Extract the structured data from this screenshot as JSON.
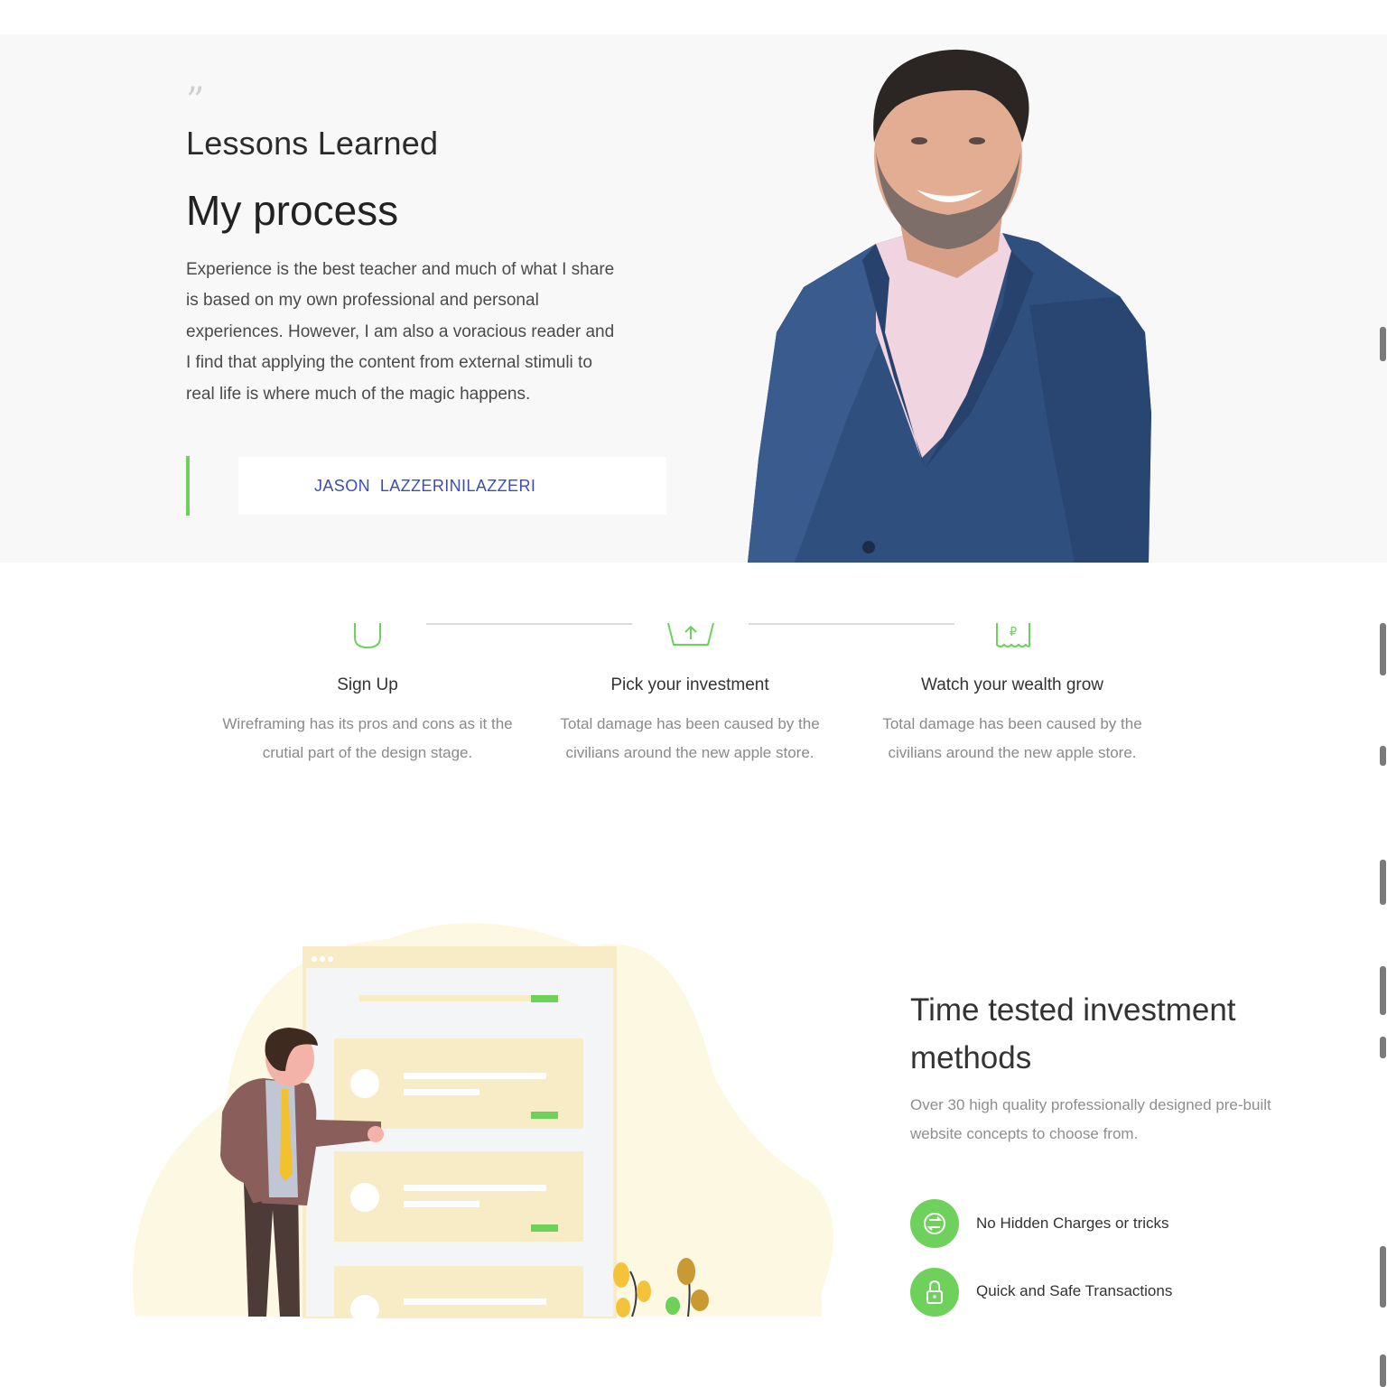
{
  "hero": {
    "quote_glyph": "”",
    "subtitle": "Lessons Learned",
    "title": "My process",
    "body": "Experience is the best teacher and much of what I share is based on my own professional and personal experiences.  However, I am also a voracious reader and I find that applying the content from external stimuli to real life is where much of the magic happens.",
    "author": "JASON  LAZZERINILAZZERI"
  },
  "steps": [
    {
      "icon": "wallet-icon",
      "title": "Sign Up",
      "desc": "Wireframing has its pros and cons as it the crutial part of the design stage."
    },
    {
      "icon": "upload-basket-icon",
      "title": "Pick your investment",
      "desc": "Total damage has been caused by the civilians around the new apple store."
    },
    {
      "icon": "receipt-icon",
      "title": "Watch your wealth grow",
      "desc": "Total damage has been caused by the civilians around the new apple store."
    }
  ],
  "features_section": {
    "title": "Time tested investment methods",
    "desc": "Over 30 high quality professionally designed pre-built website concepts to choose from.",
    "items": [
      {
        "icon": "no-charges-icon",
        "label": "No Hidden Charges or tricks"
      },
      {
        "icon": "lock-icon",
        "label": "Quick and Safe Transactions"
      }
    ]
  },
  "colors": {
    "accent_green": "#6ed15c",
    "author_blue": "#3d4db2",
    "hero_bg": "#f8f8f8"
  }
}
